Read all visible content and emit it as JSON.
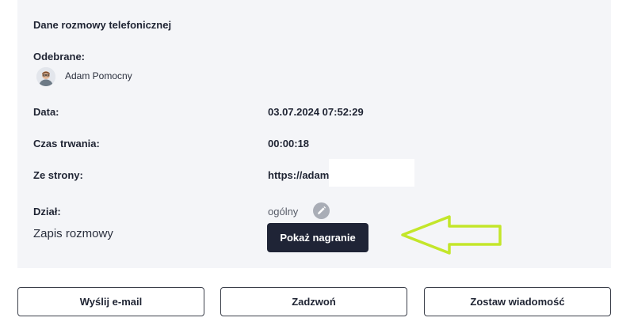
{
  "section_title": "Dane rozmowy telefonicznej",
  "received": {
    "label": "Odebrane:",
    "person_name": "Adam Pomocny"
  },
  "date": {
    "label": "Data:",
    "value": "03.07.2024 07:52:29"
  },
  "duration": {
    "label": "Czas trwania:",
    "value": "00:00:18"
  },
  "source": {
    "label": "Ze strony:",
    "value": "https://adam"
  },
  "department": {
    "label": "Dział:",
    "value": "ogólny"
  },
  "recording": {
    "label": "Zapis rozmowy",
    "button_label": "Pokaż nagranie"
  },
  "actions": {
    "email_label": "Wyślij e-mail",
    "call_label": "Zadzwoń",
    "message_label": "Zostaw wiadomość"
  },
  "colors": {
    "accent_dark": "#1f2436",
    "highlight_arrow": "#c3e62a",
    "card_bg": "#f4f5f8"
  }
}
